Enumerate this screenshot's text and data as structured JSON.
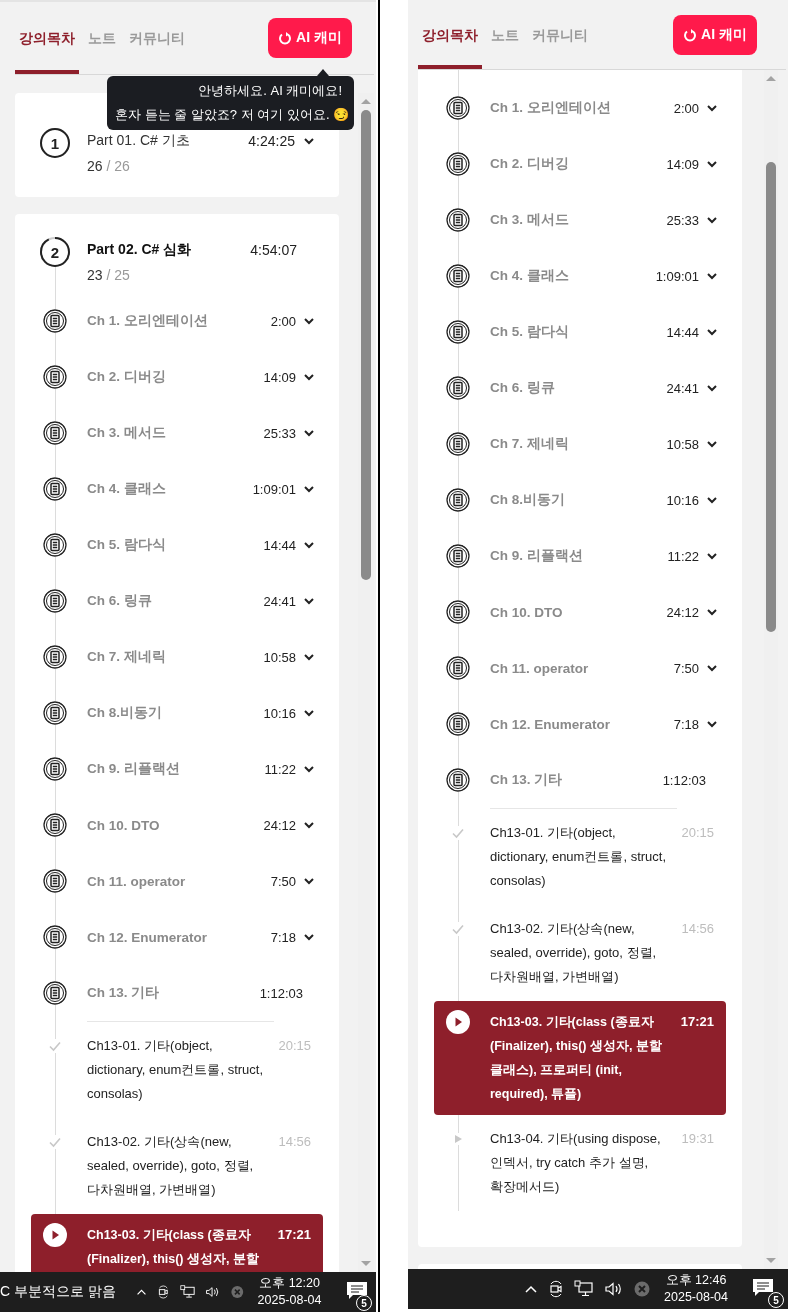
{
  "panels": [
    {
      "tabs": [
        {
          "label": "강의목차",
          "selected": true
        },
        {
          "label": "노트",
          "selected": false
        },
        {
          "label": "커뮤니티",
          "selected": false
        }
      ],
      "ai_button": "AI 캐미",
      "tooltip": [
        "안녕하세요. AI 캐미에요!",
        "혼자 듣는 줄 알았죠? 저 여기 있어요. 😏"
      ],
      "parts": [
        {
          "number": "1",
          "title": "Part 01. C# 기초",
          "duration": "4:24:25",
          "done": "26",
          "separator": "/",
          "total": "26",
          "expanded": false
        },
        {
          "number": "2",
          "title": "Part 02. C# 심화",
          "duration": "4:54:07",
          "done": "23",
          "separator": "/",
          "total": "25",
          "expanded": true,
          "chapters": [
            {
              "title": "Ch 1. 오리엔테이션",
              "duration": "2:00",
              "expanded": false
            },
            {
              "title": "Ch 2. 디버깅",
              "duration": "14:09",
              "expanded": false
            },
            {
              "title": "Ch 3. 메서드",
              "duration": "25:33",
              "expanded": false
            },
            {
              "title": "Ch 4. 클래스",
              "duration": "1:09:01",
              "expanded": false
            },
            {
              "title": "Ch 5. 람다식",
              "duration": "14:44",
              "expanded": false
            },
            {
              "title": "Ch 6. 링큐",
              "duration": "24:41",
              "expanded": false
            },
            {
              "title": "Ch 7. 제네릭",
              "duration": "10:58",
              "expanded": false
            },
            {
              "title": "Ch 8.비동기",
              "duration": "10:16",
              "expanded": false
            },
            {
              "title": "Ch 9. 리플랙션",
              "duration": "11:22",
              "expanded": false
            },
            {
              "title": "Ch 10. DTO",
              "duration": "24:12",
              "expanded": false
            },
            {
              "title": "Ch 11. operator",
              "duration": "7:50",
              "expanded": false
            },
            {
              "title": "Ch 12. Enumerator",
              "duration": "7:18",
              "expanded": false
            },
            {
              "title": "Ch 13. 기타",
              "duration": "1:12:03",
              "expanded": true,
              "lessons": [
                {
                  "kind": "completed",
                  "title": "Ch13-01. 기타(object, dictionary, enum컨트롤, struct, consolas)",
                  "duration": "20:15",
                  "selected": false
                },
                {
                  "kind": "completed",
                  "title": "Ch13-02. 기타(상속(new, sealed, override), goto, 정렬, 다차원배열, 가변배열)",
                  "duration": "14:56",
                  "selected": false
                },
                {
                  "kind": "playing",
                  "title": "Ch13-03. 기타(class (종료자 (Finalizer), this() 생성자, 분할",
                  "duration": "17:21",
                  "selected": true
                }
              ]
            }
          ]
        }
      ],
      "taskbar": {
        "weather": "C 부분적으로 맑음",
        "time": "오후 12:20",
        "date": "2025-08-04",
        "notifications": "5"
      }
    },
    {
      "tabs": [
        {
          "label": "강의목차",
          "selected": true
        },
        {
          "label": "노트",
          "selected": false
        },
        {
          "label": "커뮤니티",
          "selected": false
        }
      ],
      "ai_button": "AI 캐미",
      "parts": [
        {
          "expanded": true,
          "chapters": [
            {
              "title": "Ch 1. 오리엔테이션",
              "duration": "2:00",
              "expanded": false
            },
            {
              "title": "Ch 2. 디버깅",
              "duration": "14:09",
              "expanded": false
            },
            {
              "title": "Ch 3. 메서드",
              "duration": "25:33",
              "expanded": false
            },
            {
              "title": "Ch 4. 클래스",
              "duration": "1:09:01",
              "expanded": false
            },
            {
              "title": "Ch 5. 람다식",
              "duration": "14:44",
              "expanded": false
            },
            {
              "title": "Ch 6. 링큐",
              "duration": "24:41",
              "expanded": false
            },
            {
              "title": "Ch 7. 제네릭",
              "duration": "10:58",
              "expanded": false
            },
            {
              "title": "Ch 8.비동기",
              "duration": "10:16",
              "expanded": false
            },
            {
              "title": "Ch 9. 리플랙션",
              "duration": "11:22",
              "expanded": false
            },
            {
              "title": "Ch 10. DTO",
              "duration": "24:12",
              "expanded": false
            },
            {
              "title": "Ch 11. operator",
              "duration": "7:50",
              "expanded": false
            },
            {
              "title": "Ch 12. Enumerator",
              "duration": "7:18",
              "expanded": false
            },
            {
              "title": "Ch 13. 기타",
              "duration": "1:12:03",
              "expanded": true,
              "lessons": [
                {
                  "kind": "completed",
                  "title": "Ch13-01. 기타(object, dictionary, enum컨트롤, struct, consolas)",
                  "duration": "20:15",
                  "selected": false
                },
                {
                  "kind": "completed",
                  "title": "Ch13-02. 기타(상속(new, sealed, override), goto, 정렬, 다차원배열, 가변배열)",
                  "duration": "14:56",
                  "selected": false
                },
                {
                  "kind": "playing",
                  "title": "Ch13-03. 기타(class (종료자 (Finalizer), this() 생성자, 분할 클래스), 프로퍼티 (init, required), 튜플)",
                  "duration": "17:21",
                  "selected": true
                },
                {
                  "kind": "upcoming",
                  "title": "Ch13-04. 기타(using dispose, 인덱서, try catch 추가 설명, 확장메서드)",
                  "duration": "19:31",
                  "selected": false
                }
              ]
            }
          ]
        },
        {
          "expanded": false
        }
      ],
      "taskbar": {
        "time": "오후 12:46",
        "date": "2025-08-04",
        "notifications": "5"
      }
    }
  ]
}
